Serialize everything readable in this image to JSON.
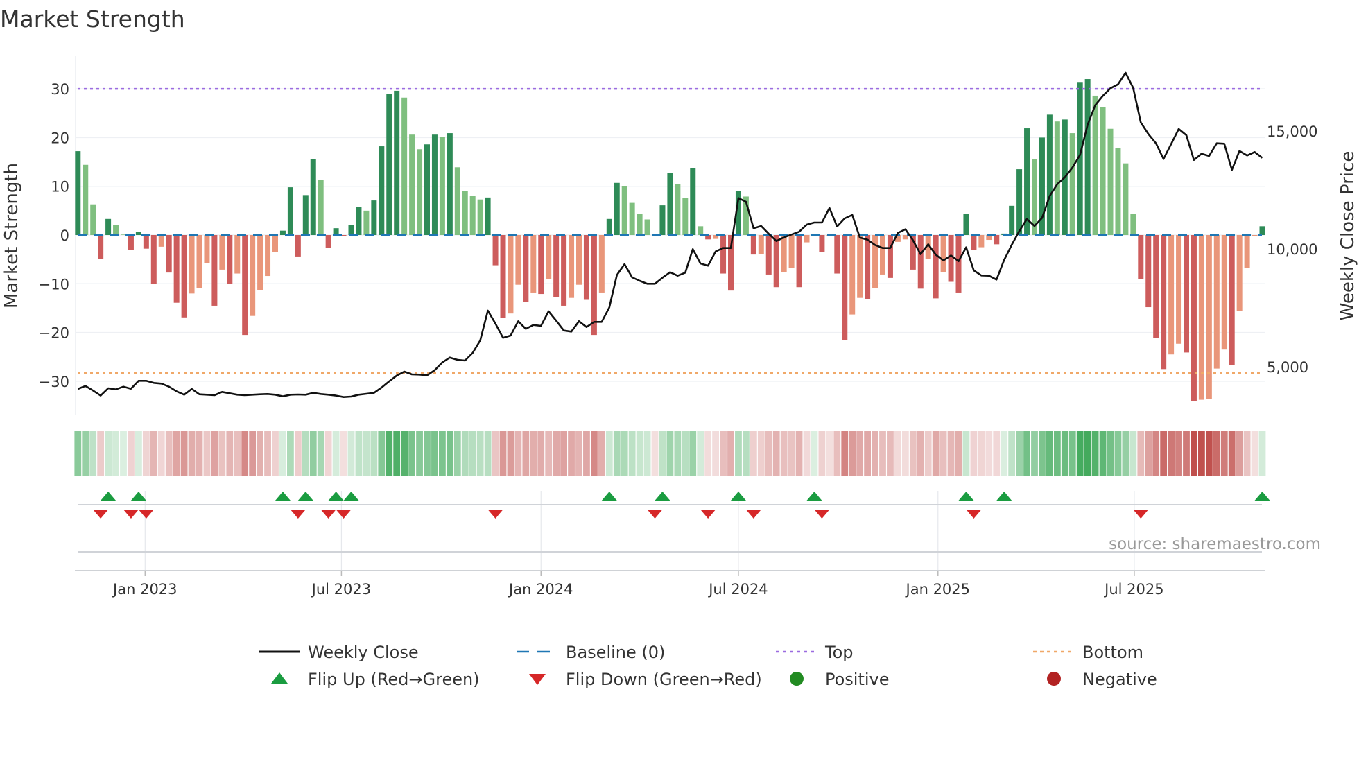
{
  "chart_data": {
    "type": "bar",
    "title": "Market Strength",
    "ylabel": "Market Strength",
    "y2label": "Weekly Close Price",
    "ylim": [
      -36.8,
      36.8
    ],
    "y2lim": [
      2970,
      18180
    ],
    "y_ticks": [
      "30",
      "20",
      "10",
      "0",
      "−10",
      "−20",
      "−30"
    ],
    "y_tick_values": [
      30,
      20,
      10,
      0,
      -10,
      -20,
      -30
    ],
    "y2_ticks": [
      "15,000",
      "10,000",
      "5,000"
    ],
    "y2_tick_values": [
      15000,
      10000,
      5000
    ],
    "x_ticks": [
      {
        "label": "Jan 2023",
        "date": "2023-01-01"
      },
      {
        "label": "Jul 2023",
        "date": "2023-07-01"
      },
      {
        "label": "Jan 2024",
        "date": "2024-01-01"
      },
      {
        "label": "Jul 2024",
        "date": "2024-07-01"
      },
      {
        "label": "Jan 2025",
        "date": "2025-01-01"
      },
      {
        "label": "Jul 2025",
        "date": "2025-07-01"
      }
    ],
    "x_start": "2022-10-31",
    "x_step_days": 7,
    "top_threshold": 30,
    "bottom_threshold": -28.3,
    "baseline": 0,
    "strength": [
      17.2,
      14.4,
      6.3,
      -4.9,
      3.3,
      2.0,
      0.1,
      -3.1,
      0.7,
      -2.8,
      -10.1,
      -2.4,
      -7.7,
      -13.9,
      -16.9,
      -12.0,
      -10.9,
      -5.7,
      -14.5,
      -7.1,
      -10.1,
      -7.9,
      -20.5,
      -16.6,
      -11.3,
      -8.4,
      -3.5,
      0.9,
      9.8,
      -4.4,
      8.2,
      15.6,
      11.3,
      -2.6,
      1.4,
      -0.2,
      2.1,
      5.7,
      5.0,
      7.1,
      18.2,
      28.9,
      29.6,
      28.2,
      20.6,
      17.6,
      18.6,
      20.6,
      20.1,
      20.9,
      13.9,
      9.1,
      8.0,
      7.3,
      7.7,
      -6.2,
      -17.0,
      -16.1,
      -10.2,
      -13.7,
      -11.8,
      -12.1,
      -9.1,
      -12.8,
      -14.5,
      -12.9,
      -10.2,
      -13.3,
      -20.5,
      -11.8,
      3.3,
      10.7,
      10.0,
      6.6,
      4.4,
      3.2,
      -0.2,
      6.1,
      12.8,
      10.4,
      7.6,
      13.7,
      1.8,
      -0.9,
      -0.8,
      -7.9,
      -11.4,
      9.1,
      7.9,
      -4.0,
      -3.9,
      -8.1,
      -10.7,
      -7.6,
      -6.7,
      -10.7,
      -1.5,
      0.2,
      -3.5,
      -0.2,
      -7.9,
      -21.6,
      -16.3,
      -12.9,
      -13.1,
      -10.9,
      -8.1,
      -8.8,
      -1.4,
      -0.9,
      -7.1,
      -11.0,
      -4.9,
      -13.0,
      -7.6,
      -9.6,
      -11.8,
      4.3,
      -3.1,
      -2.5,
      -1.0,
      -1.9,
      0.3,
      6.0,
      13.5,
      21.9,
      15.5,
      20.0,
      24.7,
      23.3,
      23.7,
      20.9,
      31.4,
      32.0,
      28.6,
      26.2,
      21.8,
      17.9,
      14.7,
      4.3,
      -9.0,
      -14.8,
      -21.1,
      -27.5,
      -24.5,
      -22.3,
      -24.1,
      -34.1,
      -33.8,
      -33.7,
      -27.4,
      -23.5,
      -26.7,
      -15.6,
      -6.7,
      -0.2,
      1.8
    ],
    "weekly_close": [
      4059,
      4186,
      3990,
      3775,
      4088,
      4039,
      4157,
      4069,
      4402,
      4402,
      4314,
      4284,
      4157,
      3960,
      3814,
      4059,
      3833,
      3814,
      3794,
      3931,
      3873,
      3814,
      3794,
      3814,
      3833,
      3843,
      3814,
      3745,
      3814,
      3824,
      3814,
      3892,
      3843,
      3814,
      3775,
      3716,
      3735,
      3814,
      3853,
      3892,
      4118,
      4382,
      4627,
      4794,
      4676,
      4667,
      4637,
      4853,
      5186,
      5392,
      5294,
      5265,
      5588,
      6118,
      7383,
      6833,
      6226,
      6324,
      6931,
      6608,
      6774,
      6735,
      7353,
      6960,
      6539,
      6490,
      6931,
      6686,
      6902,
      6902,
      7520,
      8892,
      9353,
      8794,
      8647,
      8520,
      8520,
      8775,
      9010,
      8863,
      8990,
      9990,
      9382,
      9284,
      9892,
      10039,
      10039,
      12157,
      12000,
      10873,
      10971,
      10637,
      10333,
      10490,
      10608,
      10726,
      11029,
      11118,
      11118,
      11735,
      10951,
      11294,
      11441,
      10480,
      10392,
      10167,
      10039,
      10039,
      10676,
      10833,
      10363,
      9775,
      10196,
      9755,
      9510,
      9725,
      9480,
      10069,
      9088,
      8873,
      8863,
      8696,
      9529,
      10167,
      10755,
      11265,
      10971,
      11314,
      12245,
      12745,
      13039,
      13450,
      13990,
      15265,
      16098,
      16490,
      16814,
      16980,
      17470,
      16833,
      15363,
      14873,
      14480,
      13814,
      14451,
      15088,
      14824,
      13774,
      14039,
      13941,
      14480,
      14461,
      13353,
      14157,
      13961,
      14108,
      13863
    ],
    "flip_up_weeks": [
      5,
      9,
      28,
      31,
      35,
      37,
      71,
      78,
      88,
      98,
      118,
      123,
      157
    ],
    "flip_down_weeks": [
      4,
      8,
      10,
      30,
      34,
      36,
      56,
      77,
      84,
      90,
      99,
      119,
      141
    ],
    "legend": [
      {
        "label": "Weekly Close",
        "kind": "line"
      },
      {
        "label": "Baseline (0)",
        "kind": "dash"
      },
      {
        "label": "Top",
        "kind": "dot-purple"
      },
      {
        "label": "Bottom",
        "kind": "dot-orange"
      },
      {
        "label": "Flip Up (Red→Green)",
        "kind": "tri-up"
      },
      {
        "label": "Flip Down (Green→Red)",
        "kind": "tri-down"
      },
      {
        "label": "Positive",
        "kind": "dot-green"
      },
      {
        "label": "Negative",
        "kind": "dot-red"
      }
    ],
    "legend_placement": "bottom",
    "source": "source: sharemaestro.com",
    "colors": {
      "pos_strong": "#2e8b57",
      "pos_weak": "#7fbf7f",
      "neg_strong": "#cd5c5c",
      "neg_weak": "#e9967a",
      "baseline": "#1f77b4",
      "top": "#9b6be0",
      "bottom": "#f0a868",
      "flip_up": "#1a9c40",
      "flip_down": "#d62728",
      "positive": "#228b22",
      "negative": "#b22222",
      "line": "#111111"
    }
  }
}
